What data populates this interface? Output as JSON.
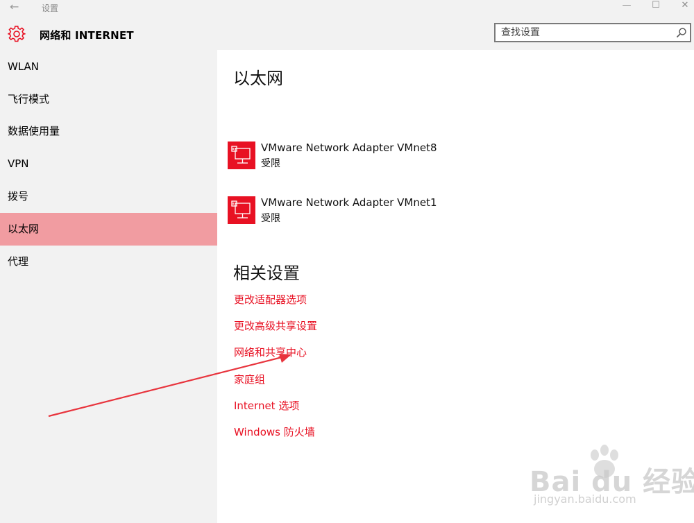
{
  "window": {
    "title": "设置",
    "min_glyph": "—",
    "max_glyph": "☐",
    "close_glyph": "✕",
    "back_glyph": "←"
  },
  "header": {
    "section_title": "网络和 INTERNET",
    "icon": "gear-icon"
  },
  "search": {
    "placeholder": "查找设置",
    "icon": "search-icon"
  },
  "sidebar": {
    "items": [
      {
        "label": "WLAN"
      },
      {
        "label": "飞行模式"
      },
      {
        "label": "数据使用量"
      },
      {
        "label": "VPN"
      },
      {
        "label": "拨号"
      },
      {
        "label": "以太网",
        "selected": true
      },
      {
        "label": "代理"
      }
    ]
  },
  "main": {
    "title": "以太网",
    "adapters": [
      {
        "name": "VMware Network Adapter VMnet8",
        "status": "受限",
        "icon": "ethernet-icon"
      },
      {
        "name": "VMware Network Adapter VMnet1",
        "status": "受限",
        "icon": "ethernet-icon"
      }
    ],
    "related_title": "相关设置",
    "related_links": [
      {
        "label": "更改适配器选项"
      },
      {
        "label": "更改高级共享设置"
      },
      {
        "label": "网络和共享中心"
      },
      {
        "label": "家庭组"
      },
      {
        "label": "Internet 选项"
      },
      {
        "label": "Windows 防火墙"
      }
    ]
  },
  "watermark": {
    "brand": "Bai du 经验",
    "url": "jingyan.baidu.com"
  },
  "colors": {
    "accent": "#e81123",
    "selected_bg": "#f19ca1",
    "sidebar_bg": "#f2f2f2",
    "annotation": "#e8343d"
  }
}
